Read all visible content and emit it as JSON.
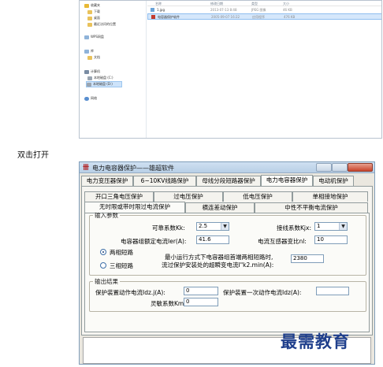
{
  "explorer": {
    "nav_items": [
      {
        "label": "收藏夹",
        "icon": "star-icon"
      },
      {
        "label": "下载",
        "icon": "download-folder-icon"
      },
      {
        "label": "桌面",
        "icon": "desktop-folder-icon"
      },
      {
        "label": "最近访问的位置",
        "icon": "recent-places-icon"
      },
      {
        "label": "WPS网盘",
        "icon": "cloud-drive-icon"
      },
      {
        "label": "库",
        "icon": "library-icon"
      },
      {
        "label": "文档",
        "icon": "documents-icon"
      },
      {
        "label": "计算机",
        "icon": "computer-icon"
      },
      {
        "label": "本地磁盘 (C:)",
        "icon": "drive-c-icon"
      },
      {
        "label": "本地磁盘 (D:)",
        "icon": "drive-d-icon"
      },
      {
        "label": "网络",
        "icon": "network-icon"
      }
    ],
    "columns": [
      "名称",
      "修改日期",
      "类型",
      "大小"
    ],
    "files": [
      {
        "name": "1.jpg",
        "date": "2013-07-13 8:48",
        "type": "JPEG 图像",
        "size": "46 KB",
        "selected": false
      },
      {
        "name": "电容器保护软件",
        "date": "2005-09-07 16:22",
        "type": "应用程序",
        "size": "476 KB",
        "selected": true
      }
    ]
  },
  "caption": "双击打开",
  "app": {
    "title": "电力电容器保护——雄超软件",
    "tabs_row1": [
      "电力变压器保护",
      "6~10KV线路保护",
      "母线分段短路器保护",
      "电力电容器保护",
      "电动机保护"
    ],
    "tabs_row2": [
      "开口三角电压保护",
      "过电压保护",
      "低电压保护",
      "单相接地保护"
    ],
    "tabs_row3": [
      "无时限或带时限过电流保护",
      "横连差动保护",
      "中性不平衡电流保护"
    ],
    "input_group": "输入参数",
    "safety_factor_label": "可靠系数Kk:",
    "safety_factor_value": "2.5",
    "wiring_factor_label": "接线系数Kjx:",
    "wiring_factor_value": "1",
    "rated_current_label": "电容器组额定电流Ier(A):",
    "rated_current_value": "41.6",
    "ct_ratio_label": "电流互感器变比nl:",
    "ct_ratio_value": "10",
    "radio_two_phase": "两相短路",
    "radio_three_phase": "三相短路",
    "min_short_label_1": "最小运行方式下电容器组首端两相短路时,",
    "min_short_label_2": "流过保护安装处的超瞬变电流I\"k2.min(A):",
    "min_short_value": "2380",
    "output_group": "输出结果",
    "op_current_label": "保护装置动作电流Idz.j(A):",
    "op_current_value": "0",
    "primary_current_label": "保护装置一次动作电流Idz(A):",
    "primary_current_value": "",
    "sensitivity_label": "灵敏系数Km:",
    "sensitivity_value": "0"
  },
  "watermark": "最需教育"
}
